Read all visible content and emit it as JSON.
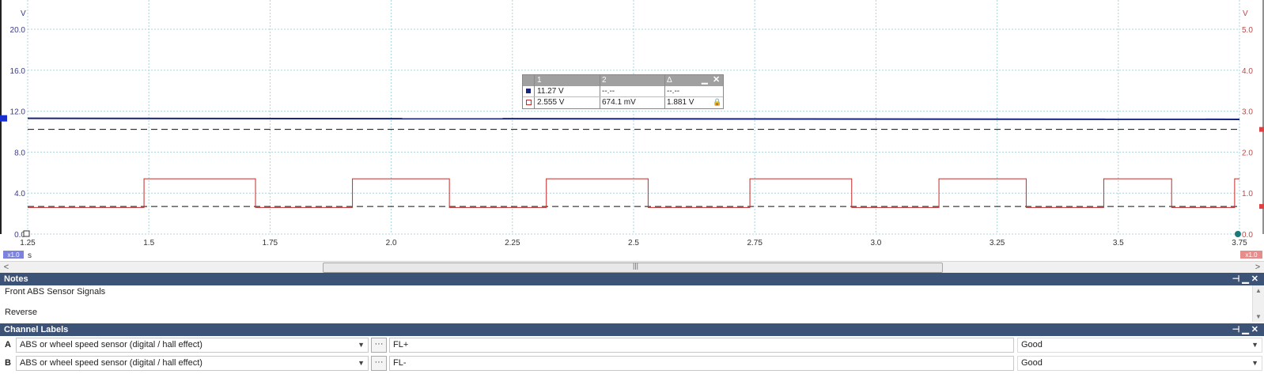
{
  "scope": {
    "left_axis": {
      "unit": "V",
      "ticks": [
        "20.0",
        "16.0",
        "12.0",
        "8.0",
        "4.0",
        "0.0"
      ],
      "color": "#3a3a8c"
    },
    "right_axis": {
      "unit": "V",
      "ticks": [
        "5.0",
        "4.0",
        "3.0",
        "2.0",
        "1.0",
        "0.0"
      ],
      "color": "#c04848"
    },
    "time_ticks": [
      "1.25",
      "1.5",
      "1.75",
      "2.0",
      "2.25",
      "2.5",
      "2.75",
      "3.0",
      "3.25",
      "3.5",
      "3.75"
    ],
    "time_unit": "s",
    "zoom_left": "x1.0",
    "zoom_right": "x1.0"
  },
  "chart_data": {
    "type": "line",
    "xlim": [
      1.25,
      3.75
    ],
    "ylim_left": [
      0,
      20
    ],
    "ylim_right": [
      0,
      5
    ],
    "grid": true,
    "series": [
      {
        "color": "#1a237e",
        "axis": "left",
        "x": [
          1.25,
          3.75
        ],
        "y": [
          11.3,
          11.2
        ]
      },
      {
        "color": "#c62828",
        "axis": "right",
        "edges": [
          1.25,
          1.49,
          1.72,
          1.92,
          2.12,
          2.32,
          2.53,
          2.74,
          2.95,
          3.13,
          3.31,
          3.47,
          3.61,
          3.74,
          3.75
        ],
        "levels": [
          0.65,
          1.35,
          0.65,
          1.35,
          0.65,
          1.35,
          0.65,
          1.35,
          0.65,
          1.35,
          0.65,
          1.35,
          0.65,
          1.35
        ]
      }
    ],
    "cursors_right": [
      2.555,
      0.674
    ]
  },
  "measurements": {
    "headers": [
      "1",
      "2",
      "Δ"
    ],
    "rows": [
      {
        "v1": "11.27 V",
        "v2": "--.--",
        "delta": "--.--",
        "color": "#1a237e"
      },
      {
        "v1": "2.555 V",
        "v2": "674.1 mV",
        "delta": "1.881 V",
        "color": "#c62828"
      }
    ]
  },
  "notes": {
    "title": "Notes",
    "lines": [
      "Front ABS Sensor Signals",
      "Reverse"
    ]
  },
  "channel_labels": {
    "title": "Channel Labels",
    "rows": [
      {
        "id": "A",
        "sensor": "ABS or wheel speed sensor (digital / hall effect)",
        "label": "FL+",
        "status": "Good"
      },
      {
        "id": "B",
        "sensor": "ABS or wheel speed sensor (digital / hall effect)",
        "label": "FL-",
        "status": "Good"
      }
    ]
  }
}
